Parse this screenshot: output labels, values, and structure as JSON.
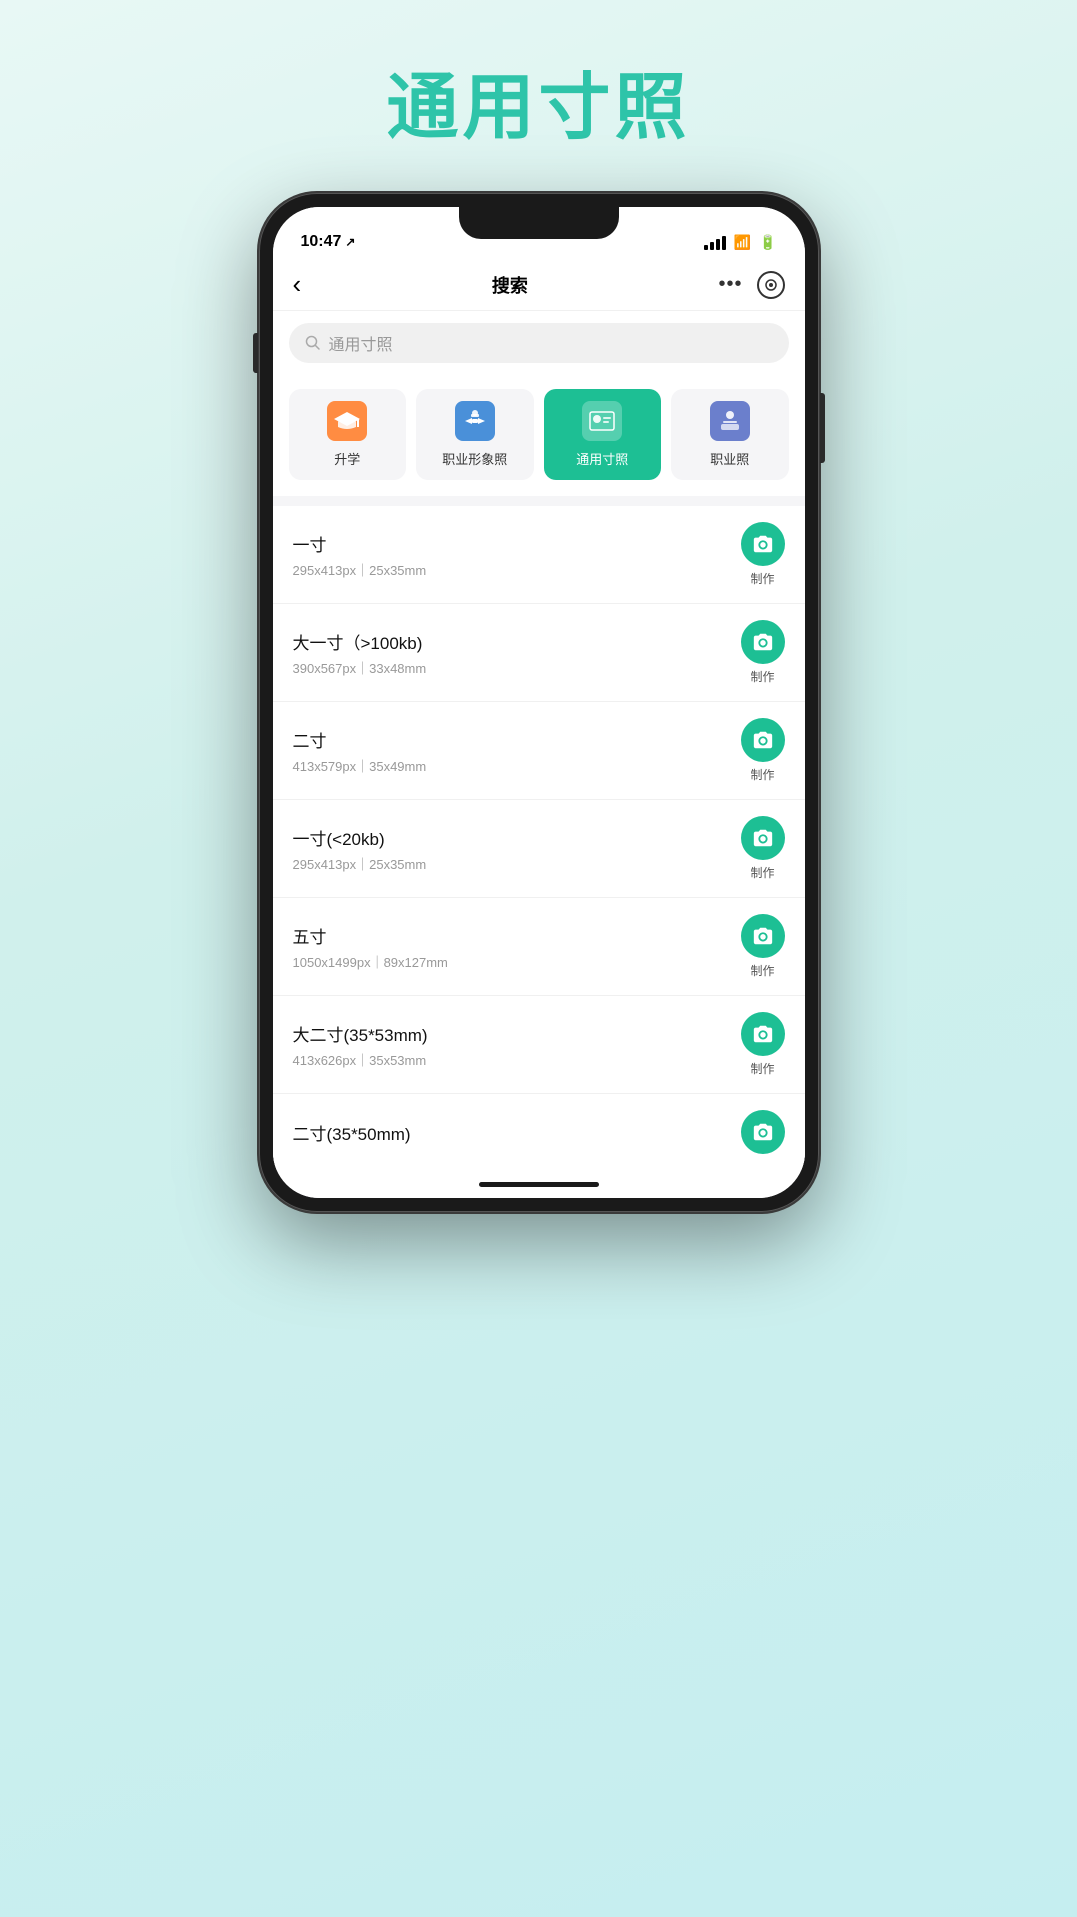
{
  "app": {
    "title": "通用寸照",
    "background_color": "#d0f0ec"
  },
  "status_bar": {
    "time": "10:47",
    "location_icon": "↗"
  },
  "nav": {
    "back_label": "‹",
    "title": "搜索",
    "dots": "•••",
    "circle_label": ""
  },
  "search": {
    "placeholder": "通用寸照",
    "icon": "🔍"
  },
  "categories": [
    {
      "id": "shengxue",
      "label": "升学",
      "active": false,
      "icon_type": "graduation"
    },
    {
      "id": "zhiyexingxiang",
      "label": "职业形象照",
      "active": false,
      "icon_type": "professional"
    },
    {
      "id": "tongyuncunzhao",
      "label": "通用寸照",
      "active": true,
      "icon_type": "id"
    },
    {
      "id": "zhiyezhao",
      "label": "职业照",
      "active": false,
      "icon_type": "work"
    }
  ],
  "photo_list": [
    {
      "name": "一寸",
      "spec": "295x413px｜25x35mm"
    },
    {
      "name": "大一寸（>100kb)",
      "spec": "390x567px｜33x48mm"
    },
    {
      "name": "二寸",
      "spec": "413x579px｜35x49mm"
    },
    {
      "name": "一寸(<20kb)",
      "spec": "295x413px｜25x35mm"
    },
    {
      "name": "五寸",
      "spec": "1050x1499px｜89x127mm"
    },
    {
      "name": "大二寸(35*53mm)",
      "spec": "413x626px｜35x53mm"
    },
    {
      "name": "二寸(35*50mm)",
      "spec": ""
    }
  ],
  "make_button_label": "制作",
  "colors": {
    "primary": "#1dbf94",
    "text_main": "#111",
    "text_sub": "#999",
    "bg": "#f5f5f7"
  }
}
